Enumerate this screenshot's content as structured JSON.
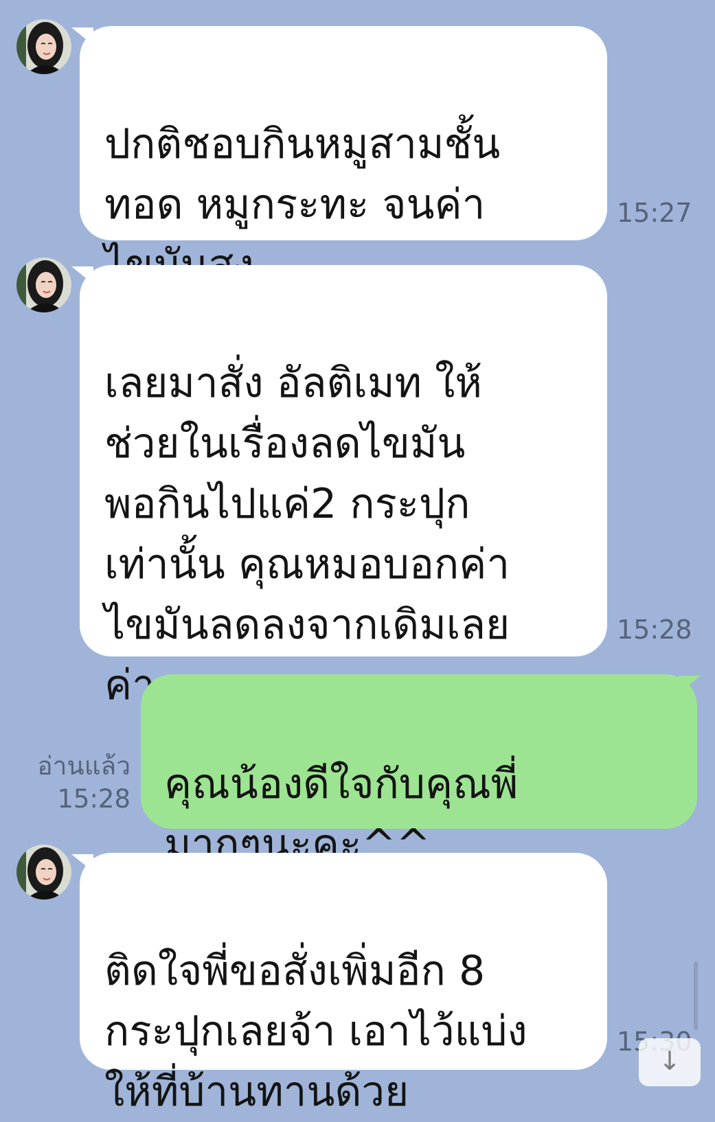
{
  "chat": {
    "messages": [
      {
        "id": "m1",
        "direction": "incoming",
        "text": "ปกติชอบกินหมูสามชั้น\nทอด หมูกระทะ จนค่า\nไขมันสูง",
        "time": "15:27"
      },
      {
        "id": "m2",
        "direction": "incoming",
        "text": "เลยมาสั่ง อัลติเมท ให้\nช่วยในเรื่องลดไขมัน\nพอกินไปแค่2 กระปุก\nเท่านั้น คุณหมอบอกค่า\nไขมันลดลงจากเดิมเลย\nค่า",
        "time": "15:28"
      },
      {
        "id": "m3",
        "direction": "outgoing",
        "text": "คุณน้องดีใจกับคุณพี่\nมากๆนะคะ^^",
        "read_label": "อ่านแล้ว",
        "time": "15:28"
      },
      {
        "id": "m4",
        "direction": "incoming",
        "text": "ติดใจพี่ขอสั่งเพิ่มอีก 8\nกระปุกเลยจ้า เอาไว้แบ่ง\nให้ที่บ้านทานด้วย",
        "time": "15:30"
      }
    ]
  },
  "icons": {
    "avatar": "user-avatar-photo",
    "scroll": "arrow-down-icon"
  },
  "colors": {
    "background": "#9fb4d8",
    "incoming_bubble": "#ffffff",
    "outgoing_bubble": "#9de492",
    "meta_text": "#55627a"
  }
}
